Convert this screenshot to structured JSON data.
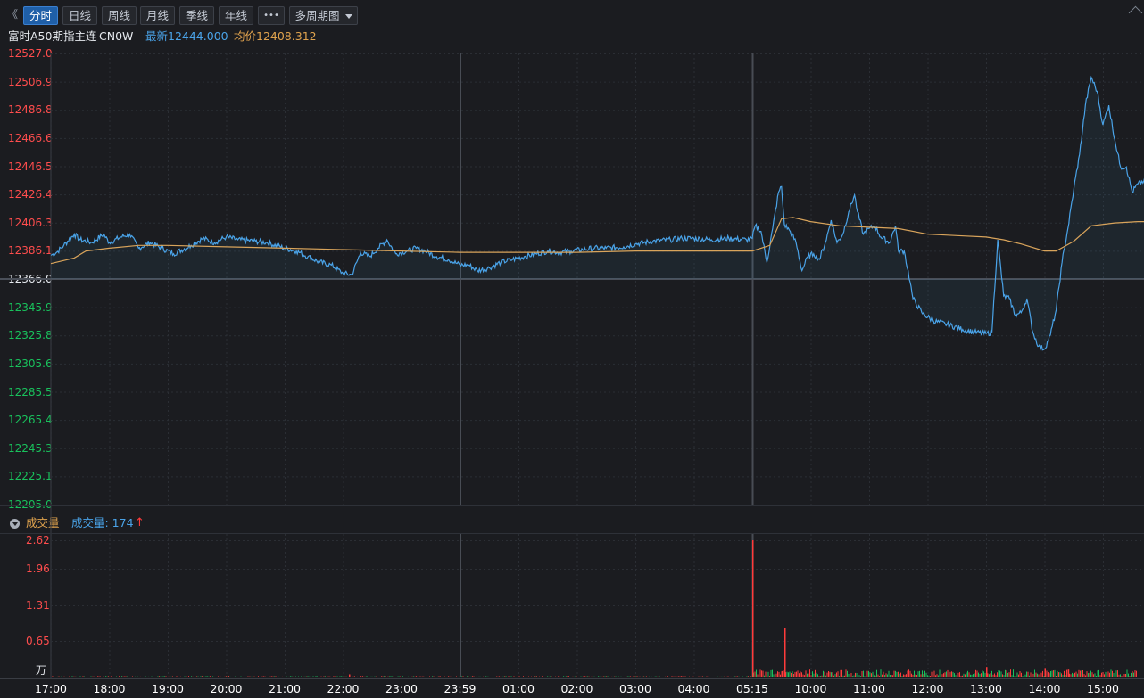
{
  "toolbar": {
    "collapse_glyph": "《",
    "tabs": [
      {
        "label": "分时",
        "active": true
      },
      {
        "label": "日线",
        "active": false
      },
      {
        "label": "周线",
        "active": false
      },
      {
        "label": "月线",
        "active": false
      },
      {
        "label": "季线",
        "active": false
      },
      {
        "label": "年线",
        "active": false
      },
      {
        "label": "•••",
        "active": false
      }
    ],
    "multi_period": "多周期图"
  },
  "quote": {
    "name": "富时A50期指主连",
    "code": "CN0W",
    "latest": "最新12444.000",
    "avg": "均价12408.312"
  },
  "volume_header": {
    "title": "成交量",
    "readout": "成交量: 174"
  },
  "colors": {
    "background": "#1b1c20",
    "grid": "#2b2e34",
    "price_line": "#4aa3e8",
    "avg_line": "#d9a45b",
    "up": "#ff3b3b",
    "down": "#19c15c",
    "accent": "#3a8ee0"
  },
  "chart_data": {
    "type": "line",
    "price_axis": {
      "ticks": [
        "12527.0",
        "12506.9",
        "12486.8",
        "12466.6",
        "12446.5",
        "12426.4",
        "12406.3",
        "12386.1",
        "12366.0",
        "12345.9",
        "12325.8",
        "12305.6",
        "12285.5",
        "12265.4",
        "12245.3",
        "12225.1",
        "12205.0"
      ],
      "baseline": "12366.0",
      "ylim": [
        12205.0,
        12527.0
      ]
    },
    "volume_axis": {
      "ticks": [
        "2.62",
        "1.96",
        "1.31",
        "0.65"
      ],
      "unit": "万",
      "ylim": [
        0,
        2.62
      ]
    },
    "x_ticks": [
      "17:00",
      "18:00",
      "19:00",
      "20:00",
      "21:00",
      "22:00",
      "23:00",
      "23:59",
      "01:00",
      "02:00",
      "03:00",
      "04:00",
      "05:15",
      "10:00",
      "11:00",
      "12:00",
      "13:00",
      "14:00",
      "15:00"
    ],
    "series": [
      {
        "name": "最新",
        "points": [
          [
            0,
            12383
          ],
          [
            0.1,
            12385
          ],
          [
            0.22,
            12390
          ],
          [
            0.4,
            12398
          ],
          [
            0.5,
            12394
          ],
          [
            0.7,
            12392
          ],
          [
            0.9,
            12398
          ],
          [
            1.0,
            12392
          ],
          [
            1.2,
            12396
          ],
          [
            1.35,
            12398
          ],
          [
            1.5,
            12388
          ],
          [
            1.7,
            12392
          ],
          [
            1.9,
            12388
          ],
          [
            2.1,
            12384
          ],
          [
            2.4,
            12390
          ],
          [
            2.6,
            12395
          ],
          [
            2.8,
            12392
          ],
          [
            3.0,
            12396
          ],
          [
            3.2,
            12394
          ],
          [
            3.5,
            12393
          ],
          [
            3.7,
            12392
          ],
          [
            4.0,
            12388
          ],
          [
            4.2,
            12386
          ],
          [
            4.4,
            12382
          ],
          [
            4.6,
            12378
          ],
          [
            4.8,
            12376
          ],
          [
            5.0,
            12370
          ],
          [
            5.15,
            12369
          ],
          [
            5.3,
            12385
          ],
          [
            5.45,
            12382
          ],
          [
            5.6,
            12388
          ],
          [
            5.75,
            12394
          ],
          [
            5.9,
            12384
          ],
          [
            6.1,
            12386
          ],
          [
            6.25,
            12388
          ],
          [
            6.4,
            12386
          ],
          [
            6.6,
            12382
          ],
          [
            6.8,
            12380
          ],
          [
            7.0,
            12376
          ],
          [
            7.15,
            12376
          ],
          [
            7.3,
            12372
          ],
          [
            7.5,
            12374
          ],
          [
            7.7,
            12378
          ],
          [
            7.9,
            12380
          ],
          [
            8.1,
            12382
          ],
          [
            8.3,
            12384
          ],
          [
            8.5,
            12386
          ],
          [
            8.7,
            12385
          ],
          [
            8.9,
            12386
          ],
          [
            9.1,
            12387
          ],
          [
            9.3,
            12388
          ],
          [
            9.5,
            12388
          ],
          [
            9.8,
            12389
          ],
          [
            10.0,
            12391
          ],
          [
            10.3,
            12393
          ],
          [
            10.6,
            12394
          ],
          [
            10.8,
            12395
          ],
          [
            11.0,
            12395
          ],
          [
            11.3,
            12394
          ],
          [
            11.6,
            12395
          ],
          [
            11.9,
            12394
          ],
          [
            12.0,
            12395
          ],
          [
            12.05,
            12404
          ],
          [
            12.15,
            12400
          ],
          [
            12.25,
            12378
          ],
          [
            12.35,
            12402
          ],
          [
            12.45,
            12428
          ],
          [
            12.5,
            12432
          ],
          [
            12.55,
            12405
          ],
          [
            12.65,
            12400
          ],
          [
            12.75,
            12392
          ],
          [
            12.85,
            12372
          ],
          [
            12.95,
            12382
          ],
          [
            13.05,
            12384
          ],
          [
            13.15,
            12380
          ],
          [
            13.25,
            12392
          ],
          [
            13.35,
            12408
          ],
          [
            13.45,
            12392
          ],
          [
            13.55,
            12398
          ],
          [
            13.65,
            12414
          ],
          [
            13.75,
            12426
          ],
          [
            13.8,
            12414
          ],
          [
            13.9,
            12398
          ],
          [
            14.0,
            12402
          ],
          [
            14.1,
            12404
          ],
          [
            14.2,
            12396
          ],
          [
            14.35,
            12392
          ],
          [
            14.45,
            12404
          ],
          [
            14.5,
            12386
          ],
          [
            14.6,
            12386
          ],
          [
            14.7,
            12364
          ],
          [
            14.75,
            12352
          ],
          [
            14.9,
            12342
          ],
          [
            15.1,
            12336
          ],
          [
            15.3,
            12334
          ],
          [
            15.6,
            12330
          ],
          [
            15.8,
            12328
          ],
          [
            16.0,
            12327
          ],
          [
            16.1,
            12328
          ],
          [
            16.2,
            12394
          ],
          [
            16.3,
            12354
          ],
          [
            16.4,
            12352
          ],
          [
            16.5,
            12340
          ],
          [
            16.6,
            12342
          ],
          [
            16.7,
            12352
          ],
          [
            16.8,
            12328
          ],
          [
            16.9,
            12318
          ],
          [
            17.0,
            12316
          ],
          [
            17.1,
            12326
          ],
          [
            17.2,
            12344
          ],
          [
            17.3,
            12378
          ],
          [
            17.4,
            12402
          ],
          [
            17.5,
            12430
          ],
          [
            17.6,
            12455
          ],
          [
            17.7,
            12490
          ],
          [
            17.8,
            12510
          ],
          [
            17.9,
            12500
          ],
          [
            18.0,
            12476
          ],
          [
            18.1,
            12490
          ],
          [
            18.2,
            12466
          ],
          [
            18.3,
            12446
          ],
          [
            18.4,
            12446
          ],
          [
            18.5,
            12428
          ],
          [
            18.6,
            12434
          ],
          [
            18.7,
            12436
          ],
          [
            18.8,
            12442
          ],
          [
            18.9,
            12444
          ]
        ]
      },
      {
        "name": "均价",
        "points": [
          [
            0,
            12377
          ],
          [
            0.4,
            12381
          ],
          [
            0.6,
            12386
          ],
          [
            1.0,
            12388
          ],
          [
            1.5,
            12390
          ],
          [
            2.0,
            12390
          ],
          [
            3.0,
            12389
          ],
          [
            4.0,
            12388
          ],
          [
            5.0,
            12387
          ],
          [
            6.0,
            12386
          ],
          [
            7.0,
            12385
          ],
          [
            8.0,
            12385
          ],
          [
            9.0,
            12385
          ],
          [
            10.0,
            12386
          ],
          [
            11.0,
            12386
          ],
          [
            12.0,
            12386
          ],
          [
            12.3,
            12390
          ],
          [
            12.5,
            12409
          ],
          [
            12.7,
            12410
          ],
          [
            13.0,
            12407
          ],
          [
            13.5,
            12404
          ],
          [
            14.0,
            12403
          ],
          [
            14.5,
            12402
          ],
          [
            15.0,
            12398
          ],
          [
            15.5,
            12397
          ],
          [
            16.0,
            12396
          ],
          [
            16.3,
            12394
          ],
          [
            16.6,
            12391
          ],
          [
            17.0,
            12386
          ],
          [
            17.2,
            12386
          ],
          [
            17.5,
            12393
          ],
          [
            17.8,
            12404
          ],
          [
            18.2,
            12406
          ],
          [
            18.6,
            12407
          ],
          [
            18.9,
            12407
          ]
        ]
      }
    ],
    "volume_spikes": [
      [
        12.0,
        2.62
      ],
      [
        12.55,
        0.95
      ],
      [
        12.5,
        0.12
      ],
      [
        5.1,
        0.06
      ],
      [
        16.0,
        0.2
      ],
      [
        17.0,
        0.18
      ],
      [
        17.4,
        0.15
      ]
    ]
  }
}
